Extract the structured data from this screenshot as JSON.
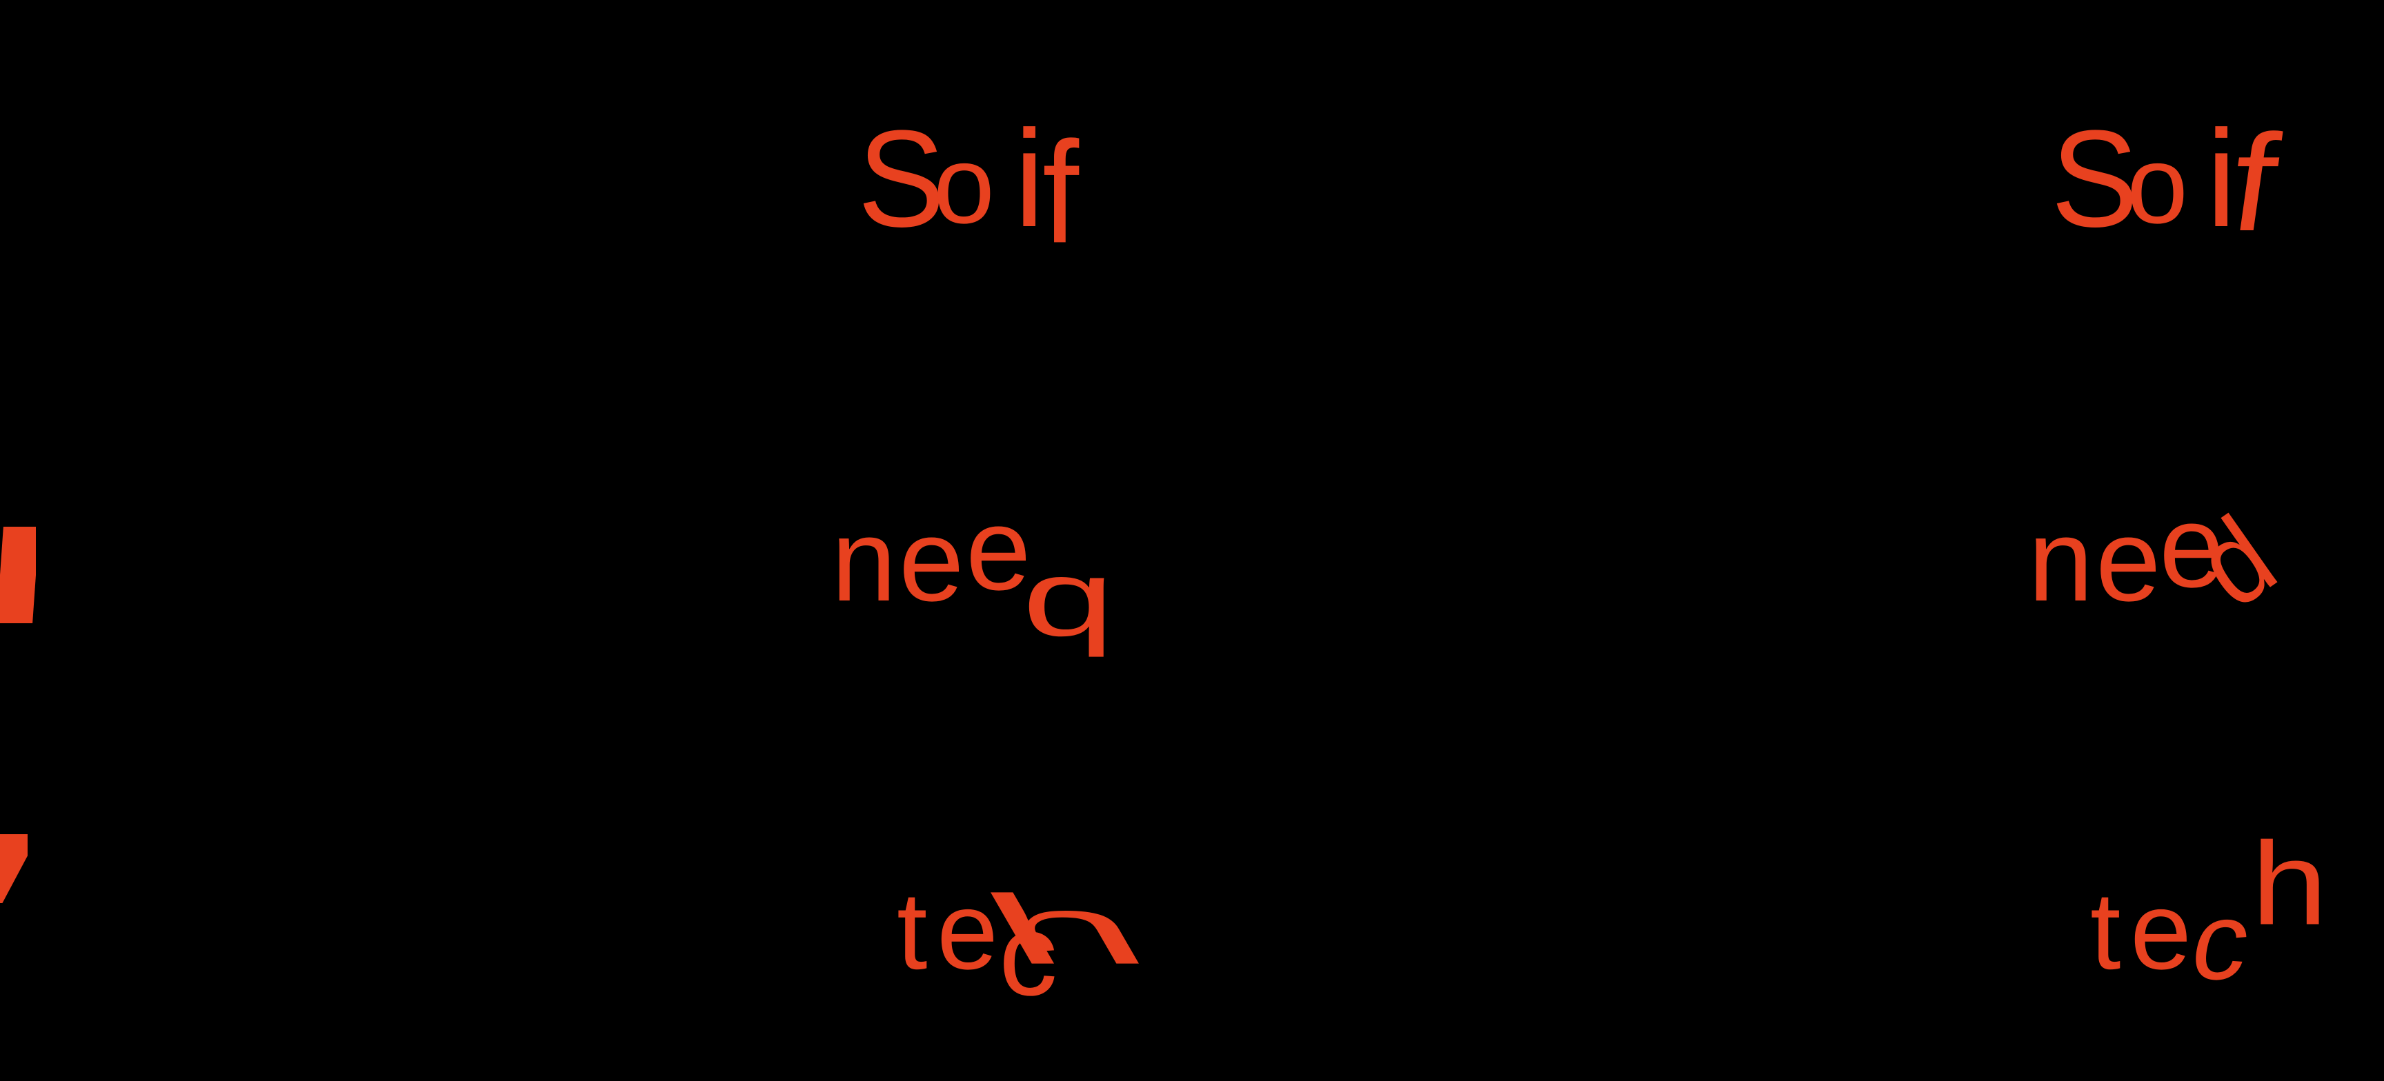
{
  "palette": {
    "background": "#000000",
    "accent": "#E8411F"
  },
  "columns": [
    {
      "name": "left-variant",
      "lines": [
        {
          "text": "So if",
          "glyphs": [
            "S",
            "o",
            "i",
            "f"
          ]
        },
        {
          "text": "need",
          "glyphs": [
            "n",
            "e",
            "e",
            "d"
          ]
        },
        {
          "text": "tech",
          "glyphs": [
            "t",
            "e",
            "c",
            "h"
          ]
        }
      ]
    },
    {
      "name": "right-variant",
      "lines": [
        {
          "text": "So if",
          "glyphs": [
            "S",
            "o",
            "i",
            "f"
          ]
        },
        {
          "text": "need",
          "glyphs": [
            "n",
            "e",
            "e",
            "d"
          ]
        },
        {
          "text": "tech",
          "glyphs": [
            "t",
            "e",
            "c",
            "h"
          ]
        }
      ]
    }
  ]
}
